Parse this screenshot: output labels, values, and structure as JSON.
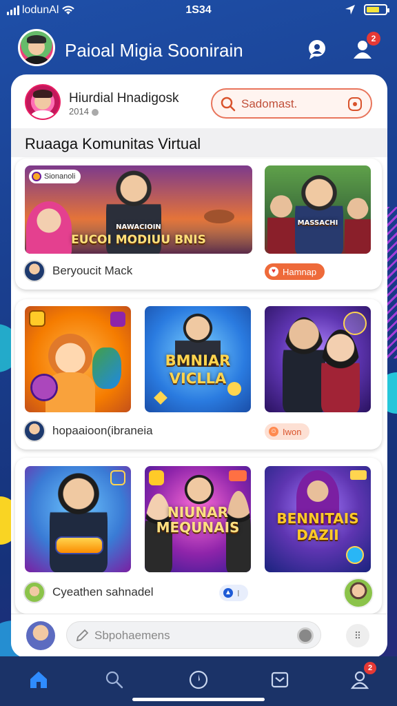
{
  "status_bar": {
    "carrier": "lodunAl",
    "time": "1S34",
    "battery_level": 0.7,
    "battery_color": "#f5e33b"
  },
  "header": {
    "title": "Paioal Migia Soonirain",
    "notification_count": "2",
    "icons": [
      "chat-icon",
      "user-notify-icon"
    ]
  },
  "profile": {
    "name": "Hiurdial Hnadigosk",
    "subtitle": "2014"
  },
  "search": {
    "placeholder": "Sadomast."
  },
  "section": {
    "title": "Ruaaga  Komunitas  Virtual"
  },
  "feed": [
    {
      "thumbs": [
        {
          "badge": "Sionanoli",
          "caption": "EUCOI MODIUU BNIS",
          "subcaption": "NAWACIOIN"
        },
        {
          "caption": "MASSACHI"
        }
      ],
      "author": "Beryoucit Mack",
      "pill": "Hamnap"
    },
    {
      "thumbs": [
        {
          "caption": ""
        },
        {
          "caption": "BMNIAR VICLLA"
        },
        {
          "caption": ""
        }
      ],
      "author": "hopaaioon(ibraneia",
      "pill": "Iwon"
    },
    {
      "thumbs": [
        {
          "caption": ""
        },
        {
          "caption": "NIUNAR MEQUNAIS"
        },
        {
          "caption": "BENNITAIS DAZII"
        }
      ],
      "author": "Cyeathen sahnadel",
      "pill": "I"
    }
  ],
  "composer": {
    "placeholder": "Sbpohaemens"
  },
  "bottom_nav": [
    "home-icon",
    "search-icon",
    "compass-icon",
    "inbox-icon",
    "profile-icon"
  ],
  "bottom_nav_badge": "2",
  "colors": {
    "accent": "#ee6a3a",
    "nav_active": "#2f8cff",
    "background": "#1a3f8f"
  }
}
